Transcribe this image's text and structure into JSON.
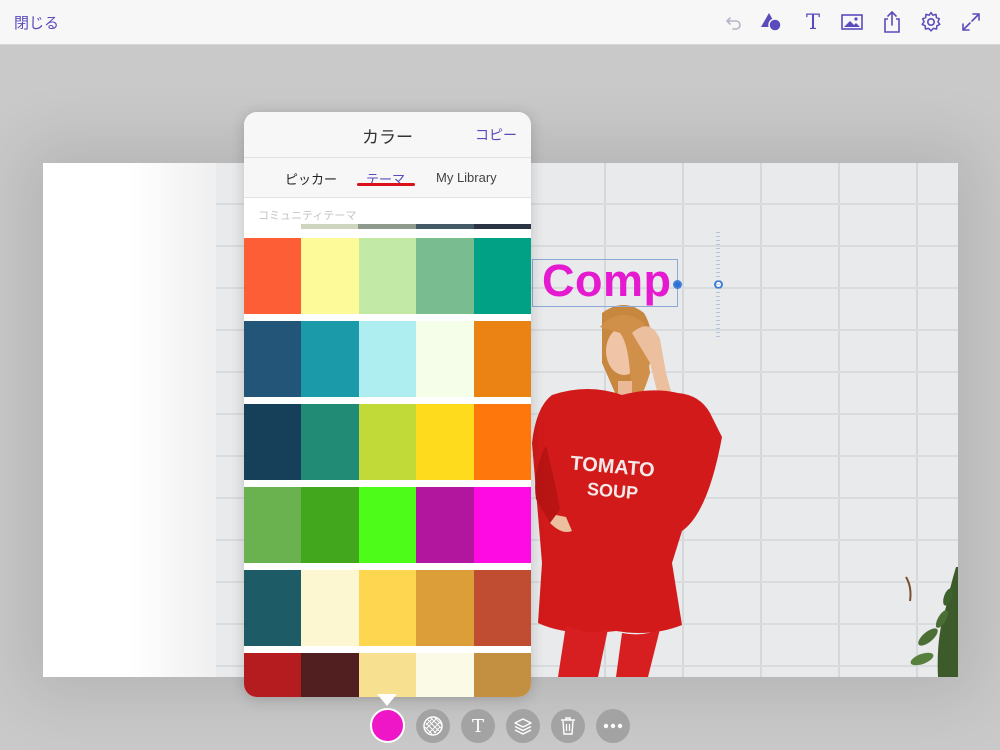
{
  "toolbar": {
    "close_label": "閉じる",
    "text_icon_glyph": "T",
    "accent_color": "#5a4bbd",
    "icons": [
      "undo-icon",
      "shapes-icon",
      "text-icon",
      "image-icon",
      "share-icon",
      "settings-icon",
      "fullscreen-icon"
    ]
  },
  "canvas": {
    "text_content": "Comp",
    "text_color": "#e519cf",
    "sweatshirt_line1": "TOMATO",
    "sweatshirt_line2": "SOUP"
  },
  "color_panel": {
    "title": "カラー",
    "copy_label": "コピー",
    "tabs": [
      {
        "label": "ピッカー",
        "active": false
      },
      {
        "label": "テーマ",
        "active": true
      },
      {
        "label": "My Library",
        "active": false
      }
    ],
    "section_label": "コミュニティテーマ",
    "themes": [
      [
        "#cdd5bf",
        "#cdd5bf",
        "#8e9a8e",
        "#425a66",
        "#2b3442"
      ],
      [
        "#fe5e36",
        "#fdfb99",
        "#c2e9a5",
        "#79bc8f",
        "#00a185"
      ],
      [
        "#235579",
        "#1b9aa9",
        "#aeeef0",
        "#f4fee8",
        "#eb8214"
      ],
      [
        "#163f59",
        "#228b75",
        "#c2da37",
        "#fedb1c",
        "#fe770c"
      ],
      [
        "#6ab24f",
        "#43a71e",
        "#4dfc18",
        "#b2169f",
        "#fe0be3"
      ],
      [
        "#1d5b66",
        "#fcf6d1",
        "#fed64f",
        "#dc9e38",
        "#c04c32"
      ],
      [
        "#b41c20",
        "#511f1f",
        "#f7e08f",
        "#fbfae7",
        "#c39042"
      ]
    ]
  },
  "bottom_bar": {
    "current_color": "#ef16c8",
    "text_glyph": "T",
    "items": [
      "color-swatch-button",
      "pattern-icon",
      "text-style-icon",
      "layers-icon",
      "trash-icon",
      "more-icon"
    ]
  }
}
